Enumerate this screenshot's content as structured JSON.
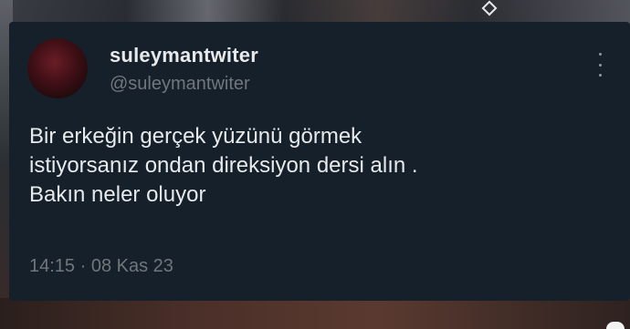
{
  "tweet": {
    "display_name": "suleymantwiter",
    "handle": "@suleymantwiter",
    "text_lines": [
      "Bir erkeğin gerçek yüzünü görmek",
      "istiyorsanız ondan direksiyon dersi alın .",
      "Bakın neler oluyor"
    ],
    "time": "14:15",
    "separator": "·",
    "date": "08 Kas 23"
  },
  "icons": {
    "more": "more-vertical-icon",
    "avatar": "profile-avatar"
  },
  "colors": {
    "card_background": "#15202b",
    "primary_text": "#e7e9ea",
    "secondary_text": "#71767b"
  }
}
